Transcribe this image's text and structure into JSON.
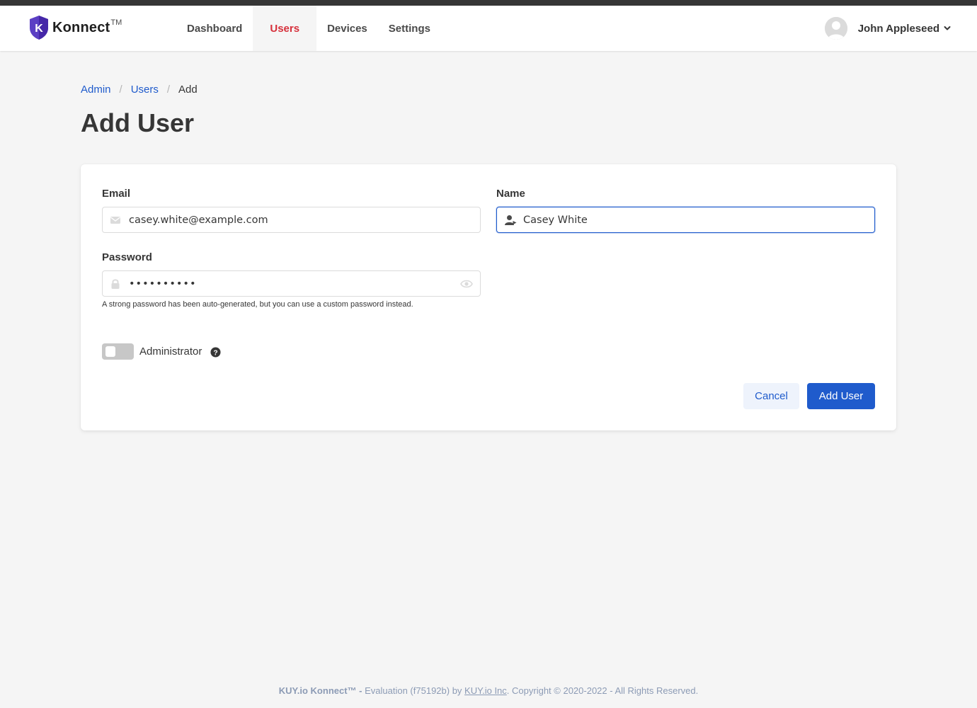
{
  "app": {
    "brand_name": "Konnect",
    "brand_tm": "TM",
    "logo_letter": "K",
    "colors": {
      "brand_purple": "#5b3fc4",
      "accent_blue": "#1f5bcc",
      "active_nav_red": "#d6303b",
      "topbar": "#363636"
    }
  },
  "nav": {
    "items": [
      {
        "label": "Dashboard",
        "active": false
      },
      {
        "label": "Users",
        "active": true
      },
      {
        "label": "Devices",
        "active": false
      },
      {
        "label": "Settings",
        "active": false
      }
    ]
  },
  "user_menu": {
    "name": "John Appleseed",
    "avatar_icon": "user-avatar-icon",
    "chevron_icon": "chevron-down-icon"
  },
  "breadcrumb": {
    "items": [
      {
        "label": "Admin",
        "link": true
      },
      {
        "label": "Users",
        "link": true
      },
      {
        "label": "Add",
        "link": false
      }
    ],
    "separator": "/"
  },
  "page": {
    "title": "Add User"
  },
  "form": {
    "email": {
      "label": "Email",
      "value": "casey.white@example.com",
      "icon": "envelope-icon"
    },
    "name": {
      "label": "Name",
      "value": "Casey White",
      "icon": "user-icon",
      "focused": true
    },
    "password": {
      "label": "Password",
      "value": "••••••••••",
      "icon": "lock-icon",
      "reveal_icon": "eye-icon",
      "help": "A strong password has been auto-generated, but you can use a custom password instead."
    },
    "administrator": {
      "label": "Administrator",
      "checked": false,
      "help_icon": "question-circle-icon"
    },
    "cancel_label": "Cancel",
    "submit_label": "Add User"
  },
  "footer": {
    "brand": "KUY.io Konnect™ -",
    "text_1": " Evaluation (f75192b) by ",
    "link": "KUY.io Inc",
    "text_2": ". Copyright © 2020-2022 - All Rights Reserved."
  }
}
